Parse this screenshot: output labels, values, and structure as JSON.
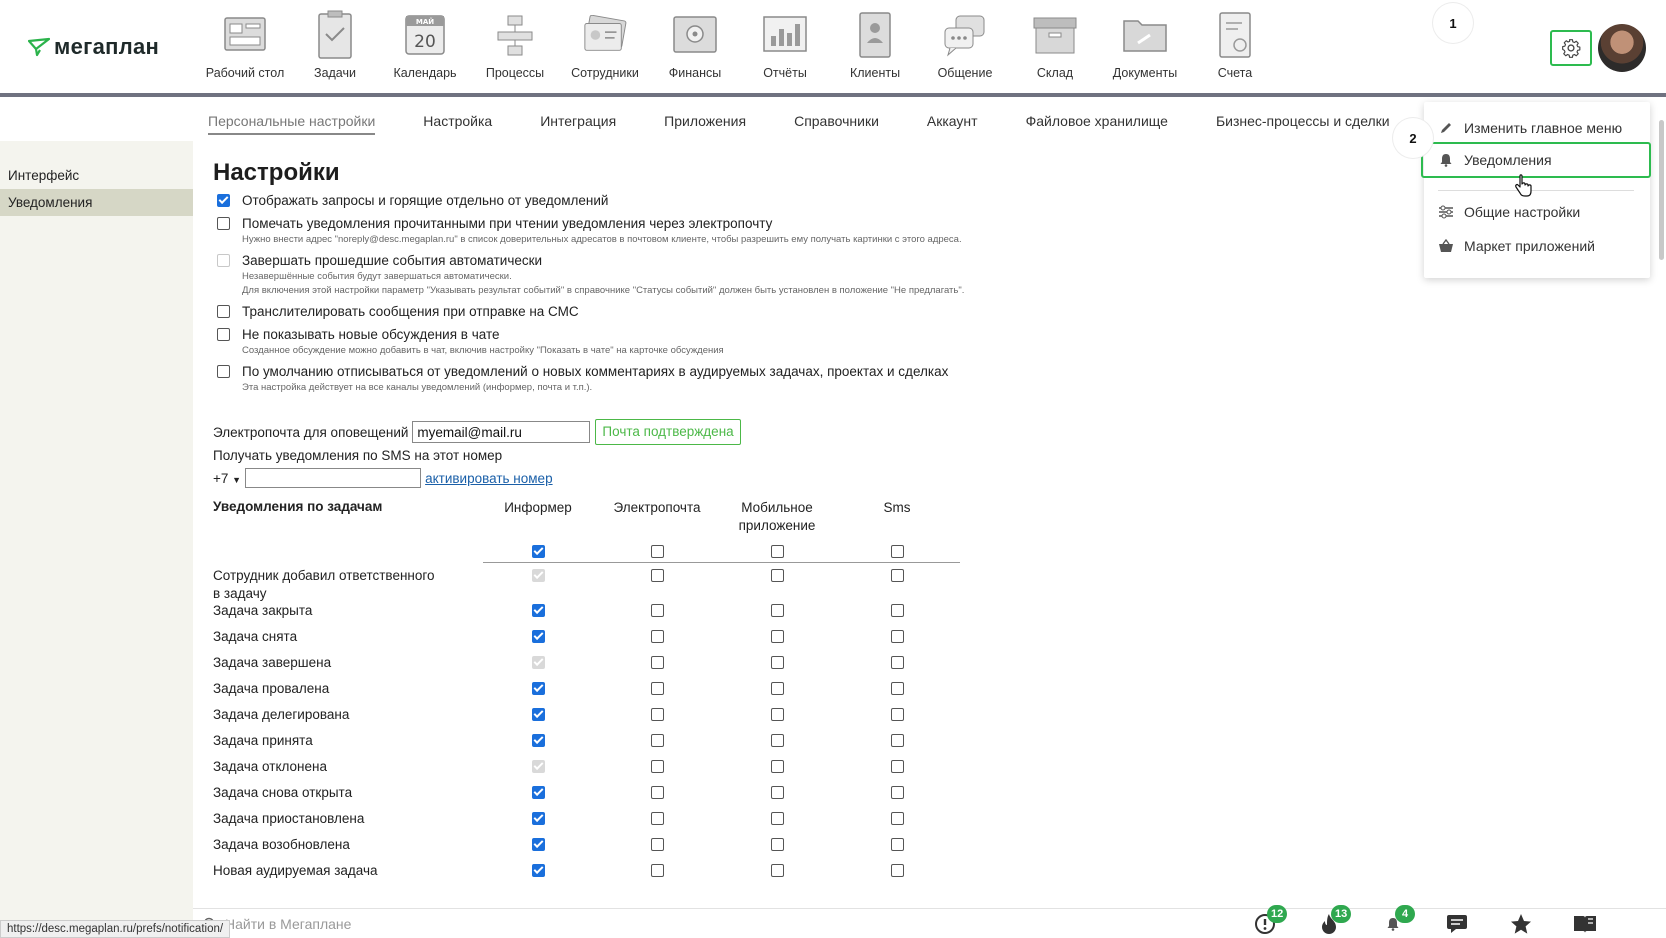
{
  "app": {
    "logo_text": "мегаплан"
  },
  "modules": [
    {
      "label": "Рабочий стол",
      "icon": "desktop-icon"
    },
    {
      "label": "Задачи",
      "icon": "clipboard-check-icon"
    },
    {
      "label": "Календарь",
      "icon": "calendar-icon",
      "month": "МАЙ",
      "day": "20"
    },
    {
      "label": "Процессы",
      "icon": "process-icon"
    },
    {
      "label": "Сотрудники",
      "icon": "id-card-icon"
    },
    {
      "label": "Финансы",
      "icon": "safe-icon"
    },
    {
      "label": "Отчёты",
      "icon": "chart-icon"
    },
    {
      "label": "Клиенты",
      "icon": "address-book-icon"
    },
    {
      "label": "Общение",
      "icon": "chat-bubbles-icon"
    },
    {
      "label": "Склад",
      "icon": "box-icon"
    },
    {
      "label": "Документы",
      "icon": "folder-icon"
    },
    {
      "label": "Счета",
      "icon": "invoice-icon"
    }
  ],
  "markers": {
    "one": "1",
    "two": "2"
  },
  "subnav": {
    "tabs": [
      "Персональные настройки",
      "Настройка",
      "Интеграция",
      "Приложения",
      "Справочники",
      "Аккаунт",
      "Файловое хранилище",
      "Бизнес-процессы и сделки"
    ],
    "active": 0
  },
  "sidebar": {
    "items": [
      "Интерфейс",
      "Уведомления"
    ],
    "active": 1
  },
  "main": {
    "title": "Настройки",
    "options": [
      {
        "label": "Отображать запросы и горящие отдельно от уведомлений",
        "checked": true,
        "hints": []
      },
      {
        "label": "Помечать уведомления прочитанными при чтении уведомления через электропочту",
        "checked": false,
        "hints": [
          "Нужно внести адрес \"noreply@desc.megaplan.ru\" в список доверительных адресатов в почтовом клиенте, чтобы разрешить ему получать картинки с этого адреса."
        ]
      },
      {
        "label": "Завершать прошедшие события автоматически",
        "checked": false,
        "disabled": true,
        "hints": [
          "Незавершённые события будут завершаться автоматически.",
          "Для включения этой настройки параметр \"Указывать результат событий\" в справочнике \"Статусы событий\" должен быть установлен в положение \"Не предлагать\"."
        ]
      },
      {
        "label": "Транслителировать сообщения при отправке на СМС",
        "checked": false,
        "hints": []
      },
      {
        "label": "Не показывать новые обсуждения в чате",
        "checked": false,
        "hints": [
          "Созданное обсуждение можно добавить в чат, включив настройку \"Показать в чате\" на карточке обсуждения"
        ]
      },
      {
        "label": "По умолчанию отписываться от уведомлений о новых комментариях в аудируемых задачах, проектах и сделках",
        "checked": false,
        "hints": [
          "Эта настройка действует на все каналы уведомлений (информер, почта и т.п.)."
        ]
      }
    ],
    "email": {
      "label": "Электропочта для оповещений",
      "value": "myemail@mail.ru",
      "confirmed": "Почта подтверждена"
    },
    "sms": {
      "title": "Получать уведомления по SMS на этот номер",
      "prefix": "+7",
      "value": "",
      "activate_link": "активировать номер"
    }
  },
  "notifications_table": {
    "title": "Уведомления по задачам",
    "columns": [
      "Информер",
      "Электропочта",
      "Мобильное приложение",
      "Sms"
    ],
    "header_checks": [
      "on",
      "off",
      "off",
      "off"
    ],
    "rows": [
      {
        "label": "Сотрудник добавил ответственного в задачу",
        "cells": [
          "dison",
          "off",
          "off",
          "off"
        ]
      },
      {
        "label": "Задача закрыта",
        "cells": [
          "on",
          "off",
          "off",
          "off"
        ]
      },
      {
        "label": "Задача снята",
        "cells": [
          "on",
          "off",
          "off",
          "off"
        ]
      },
      {
        "label": "Задача завершена",
        "cells": [
          "dison",
          "off",
          "off",
          "off"
        ]
      },
      {
        "label": "Задача провалена",
        "cells": [
          "on",
          "off",
          "off",
          "off"
        ]
      },
      {
        "label": "Задача делегирована",
        "cells": [
          "on",
          "off",
          "off",
          "off"
        ]
      },
      {
        "label": "Задача принята",
        "cells": [
          "on",
          "off",
          "off",
          "off"
        ]
      },
      {
        "label": "Задача отклонена",
        "cells": [
          "dison",
          "off",
          "off",
          "off"
        ]
      },
      {
        "label": "Задача снова открыта",
        "cells": [
          "on",
          "off",
          "off",
          "off"
        ]
      },
      {
        "label": "Задача приостановлена",
        "cells": [
          "on",
          "off",
          "off",
          "off"
        ]
      },
      {
        "label": "Задача возобновлена",
        "cells": [
          "on",
          "off",
          "off",
          "off"
        ]
      },
      {
        "label": "Новая аудируемая задача",
        "cells": [
          "on",
          "off",
          "off",
          "off"
        ]
      }
    ]
  },
  "dropdown": {
    "items": [
      {
        "label": "Изменить главное меню",
        "icon": "pencil-icon"
      },
      {
        "label": "Уведомления",
        "icon": "bell-icon",
        "highlighted": true
      },
      {
        "label": "Общие настройки",
        "icon": "sliders-icon"
      },
      {
        "label": "Маркет приложений",
        "icon": "basket-icon"
      }
    ]
  },
  "bottom": {
    "search_placeholder": "Найти в Мегаплане",
    "icons": [
      {
        "icon": "alert-icon",
        "badge": "12"
      },
      {
        "icon": "fire-icon",
        "badge": "13"
      },
      {
        "icon": "bell-icon",
        "badge": "4"
      },
      {
        "icon": "chat-icon",
        "badge": ""
      },
      {
        "icon": "star-icon",
        "badge": ""
      },
      {
        "icon": "book-icon",
        "badge": ""
      }
    ],
    "status_url": "https://desc.megaplan.ru/prefs/notification/"
  },
  "colors": {
    "accent_green": "#2dbb4f",
    "checkbox_blue": "#1a6fdc",
    "link_blue": "#1a5fa8",
    "sidebar_bg": "#f4f4ee",
    "sidebar_active": "#d6d7c6"
  }
}
